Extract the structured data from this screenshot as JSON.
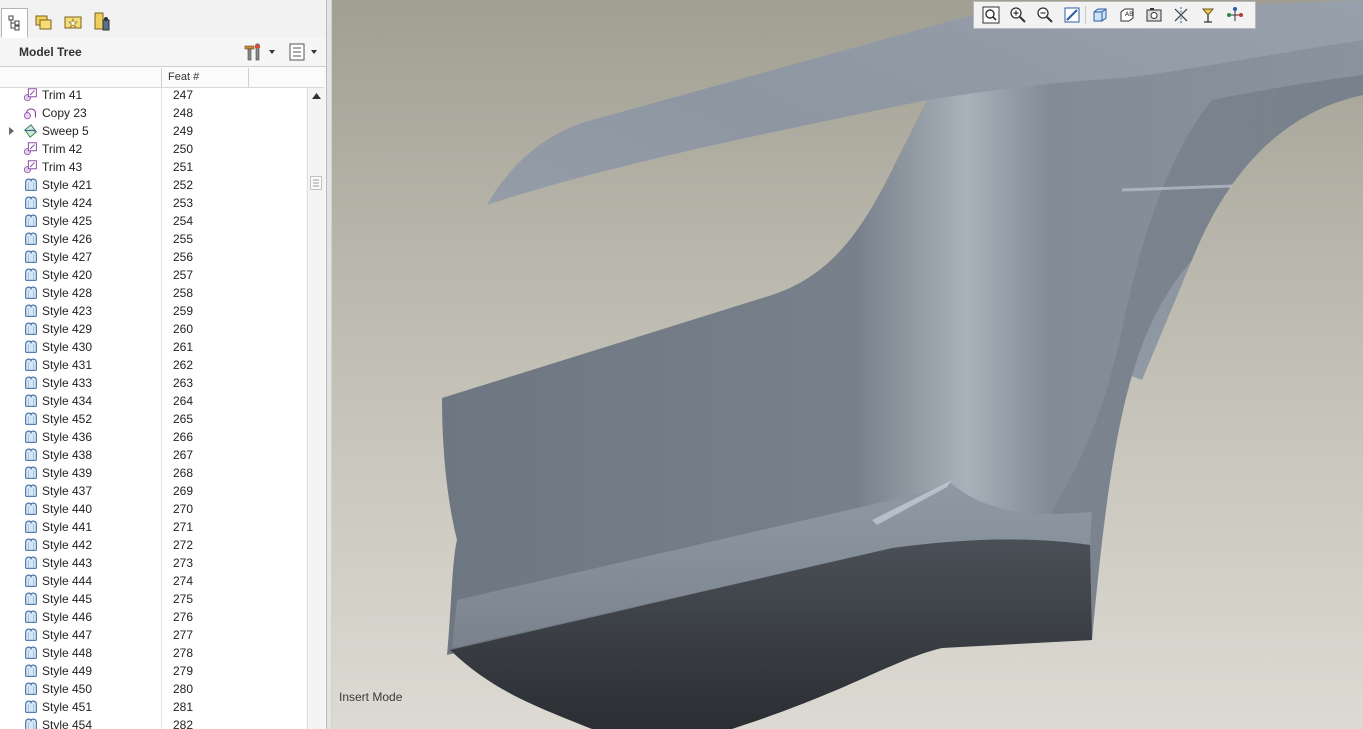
{
  "panel": {
    "nav_tabs": [
      "model-tree-tab",
      "folder-browser-tab",
      "favorites-tab",
      "connections-tab"
    ],
    "title": "Model Tree",
    "columns": [
      "",
      "Feat #"
    ]
  },
  "tree": {
    "rows": [
      {
        "name": "Trim 41",
        "feat": "247",
        "icon": "trim-icon"
      },
      {
        "name": "Copy 23",
        "feat": "248",
        "icon": "copy-icon"
      },
      {
        "name": "Sweep 5",
        "feat": "249",
        "icon": "sweep-icon",
        "expandable": true
      },
      {
        "name": "Trim 42",
        "feat": "250",
        "icon": "trim-icon"
      },
      {
        "name": "Trim 43",
        "feat": "251",
        "icon": "trim-icon"
      },
      {
        "name": "Style 421",
        "feat": "252",
        "icon": "style-icon"
      },
      {
        "name": "Style 424",
        "feat": "253",
        "icon": "style-icon"
      },
      {
        "name": "Style 425",
        "feat": "254",
        "icon": "style-icon"
      },
      {
        "name": "Style 426",
        "feat": "255",
        "icon": "style-icon"
      },
      {
        "name": "Style 427",
        "feat": "256",
        "icon": "style-icon"
      },
      {
        "name": "Style 420",
        "feat": "257",
        "icon": "style-icon"
      },
      {
        "name": "Style 428",
        "feat": "258",
        "icon": "style-icon"
      },
      {
        "name": "Style 423",
        "feat": "259",
        "icon": "style-icon"
      },
      {
        "name": "Style 429",
        "feat": "260",
        "icon": "style-icon"
      },
      {
        "name": "Style 430",
        "feat": "261",
        "icon": "style-icon"
      },
      {
        "name": "Style 431",
        "feat": "262",
        "icon": "style-icon"
      },
      {
        "name": "Style 433",
        "feat": "263",
        "icon": "style-icon"
      },
      {
        "name": "Style 434",
        "feat": "264",
        "icon": "style-icon"
      },
      {
        "name": "Style 452",
        "feat": "265",
        "icon": "style-icon"
      },
      {
        "name": "Style 436",
        "feat": "266",
        "icon": "style-icon"
      },
      {
        "name": "Style 438",
        "feat": "267",
        "icon": "style-icon"
      },
      {
        "name": "Style 439",
        "feat": "268",
        "icon": "style-icon"
      },
      {
        "name": "Style 437",
        "feat": "269",
        "icon": "style-icon"
      },
      {
        "name": "Style 440",
        "feat": "270",
        "icon": "style-icon"
      },
      {
        "name": "Style 441",
        "feat": "271",
        "icon": "style-icon"
      },
      {
        "name": "Style 442",
        "feat": "272",
        "icon": "style-icon"
      },
      {
        "name": "Style 443",
        "feat": "273",
        "icon": "style-icon"
      },
      {
        "name": "Style 444",
        "feat": "274",
        "icon": "style-icon"
      },
      {
        "name": "Style 445",
        "feat": "275",
        "icon": "style-icon"
      },
      {
        "name": "Style 446",
        "feat": "276",
        "icon": "style-icon"
      },
      {
        "name": "Style 447",
        "feat": "277",
        "icon": "style-icon"
      },
      {
        "name": "Style 448",
        "feat": "278",
        "icon": "style-icon"
      },
      {
        "name": "Style 449",
        "feat": "279",
        "icon": "style-icon"
      },
      {
        "name": "Style 450",
        "feat": "280",
        "icon": "style-icon"
      },
      {
        "name": "Style 451",
        "feat": "281",
        "icon": "style-icon"
      },
      {
        "name": "Style 454",
        "feat": "282",
        "icon": "style-icon"
      }
    ]
  },
  "graphics_toolbar": {
    "buttons": [
      "refit-icon",
      "zoom-in-icon",
      "zoom-out-icon",
      "repaint-icon",
      "display-style-icon",
      "saved-views-icon",
      "view-manager-icon",
      "datum-display-icon",
      "spin-center-icon",
      "annotation-display-icon"
    ]
  },
  "status": {
    "mode": "Insert Mode"
  },
  "colors": {
    "background_top": "#a19f92",
    "background_bottom": "#dcdad2",
    "surface": "#8c95a0"
  }
}
